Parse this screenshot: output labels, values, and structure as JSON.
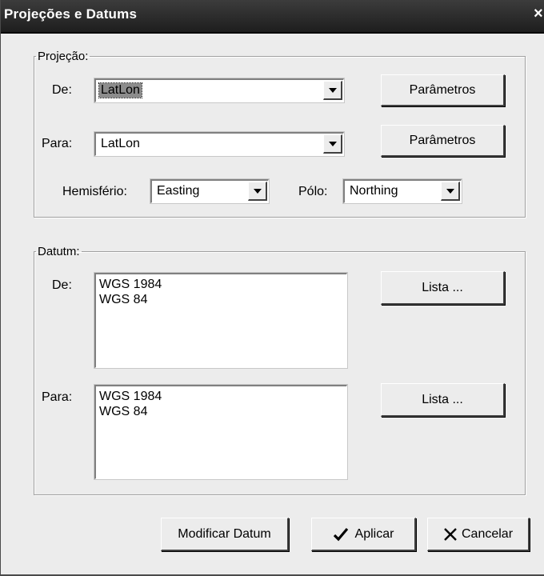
{
  "window": {
    "title": "Projeções e Datums",
    "close_glyph": "×"
  },
  "projection": {
    "legend": "Projeção:",
    "from_label": "De:",
    "from_value": "LatLon",
    "to_label": "Para:",
    "to_value": "LatLon",
    "params_label": "Parâmetros",
    "hemisphere_label": "Hemisfério:",
    "hemisphere_value": "Easting",
    "pole_label": "Pólo:",
    "pole_value": "Northing"
  },
  "datum": {
    "legend": "Datutm:",
    "from_label": "De:",
    "from_items": [
      "WGS 1984",
      "WGS 84"
    ],
    "to_label": "Para:",
    "to_items": [
      "WGS 1984",
      "WGS 84"
    ],
    "list_label": "Lista ..."
  },
  "buttons": {
    "modify": "Modificar Datum",
    "apply": "Aplicar",
    "cancel": "Cancelar"
  },
  "icons": {
    "apply": "checkmark-icon",
    "cancel": "x-cross-icon",
    "dropdown": "chevron-down-icon"
  }
}
